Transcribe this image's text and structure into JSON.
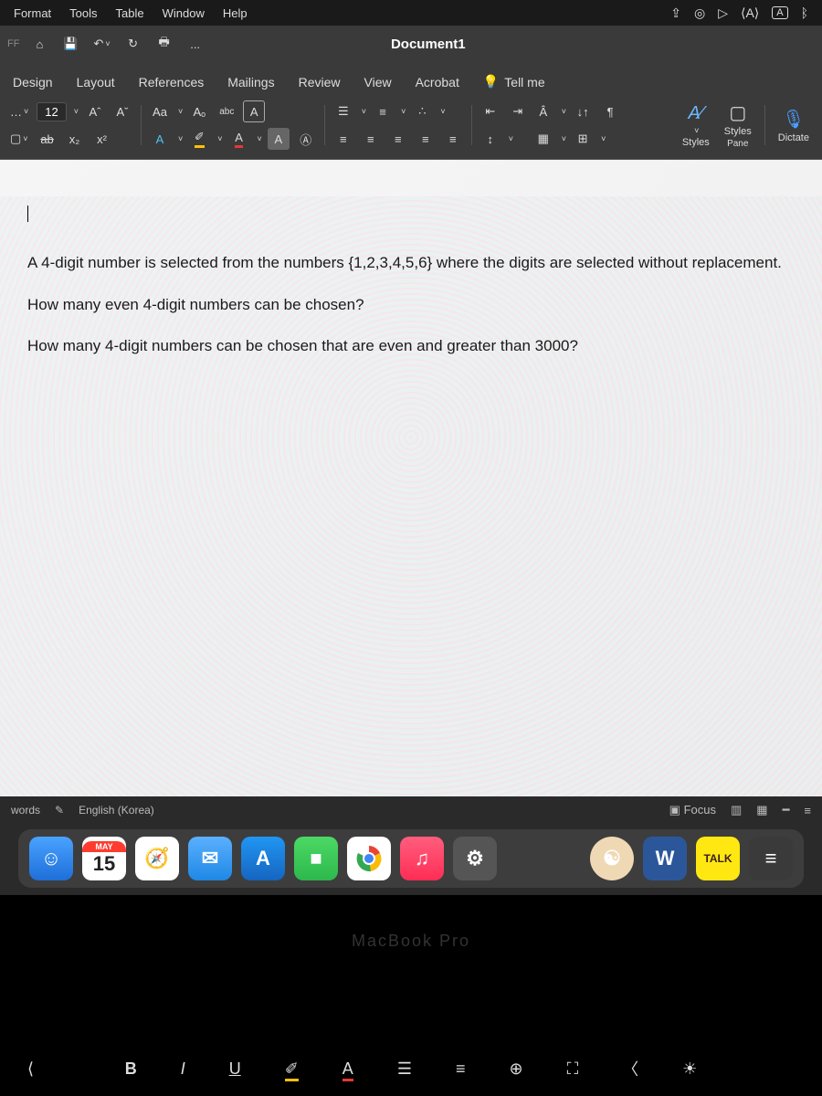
{
  "mac_menu": {
    "items": [
      "Format",
      "Tools",
      "Table",
      "Window",
      "Help"
    ]
  },
  "menubar_icons": [
    "dropbox-icon",
    "screen-record-icon",
    "play-icon",
    "language-icon",
    "input-a-icon",
    "bluetooth-icon"
  ],
  "qat": {
    "ff_label": "FF",
    "doc_title": "Document1",
    "ellipsis": "..."
  },
  "ribbon_tabs": [
    "Design",
    "Layout",
    "References",
    "Mailings",
    "Review",
    "View",
    "Acrobat"
  ],
  "tell_me": "Tell me",
  "font": {
    "size": "12",
    "increase": "Aˆ",
    "decrease": "Aˇ",
    "case": "Aa",
    "clear": "Aₒ",
    "phonetic": "abc",
    "char_border": "A"
  },
  "row2": {
    "strike": "ab",
    "sub": "x₂",
    "sup": "x²",
    "effects": "A",
    "highlight": "✐",
    "fontcolor": "A",
    "shading": "A",
    "charfmt": "Ⓐ"
  },
  "para": {
    "bullets": "☰",
    "numbers": "≡",
    "multilevel": "∴",
    "dec_indent": "⇤",
    "inc_indent": "⇥",
    "asian": "Â",
    "sort": "↓↑",
    "pilcrow": "¶",
    "left": "≡",
    "center": "≡",
    "right": "≡",
    "justify": "≡",
    "distrib": "≡",
    "spacing": "↕",
    "fill": "▦",
    "borders": "⊞"
  },
  "styles": {
    "label1": "Styles",
    "label2": "Styles",
    "pane": "Pane",
    "dictate": "Dictate"
  },
  "document": {
    "p1": "A 4-digit number is selected from the numbers {1,2,3,4,5,6} where the digits are selected without replacement.",
    "p2": "How many even 4-digit numbers can be chosen?",
    "p3": "How many 4-digit numbers can be chosen that are even and greater than 3000?"
  },
  "status": {
    "words": "words",
    "lang": "English (Korea)",
    "focus": "Focus"
  },
  "calendar": {
    "month": "MAY",
    "day": "15"
  },
  "dock_talk": "TALK",
  "dock_w": "W",
  "macbook": "MacBook Pro",
  "touchbar": {
    "b": "B",
    "i": "I",
    "u": "U",
    "hl": "✐",
    "a": "A",
    "bullets": "☰",
    "numbers": "≡",
    "new": "⊕",
    "full": "⛶",
    "back": "〈",
    "bright": "☀"
  }
}
